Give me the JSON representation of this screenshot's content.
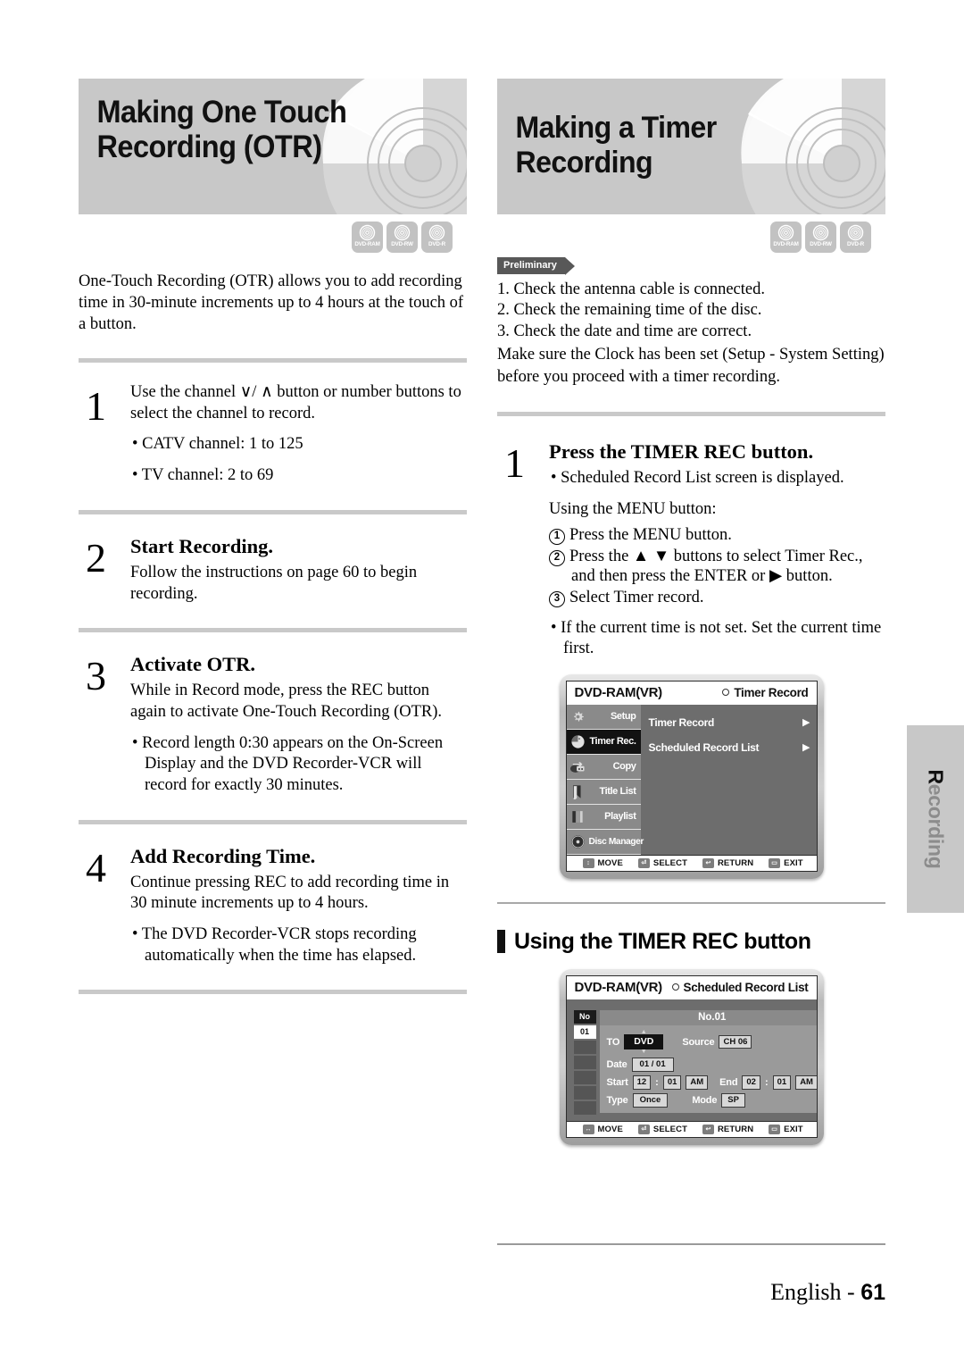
{
  "left": {
    "banner_title": "Making One Touch\nRecording (OTR)",
    "badges": [
      {
        "label": "DVD-RAM"
      },
      {
        "label": "DVD-RW"
      },
      {
        "label": "DVD-R"
      }
    ],
    "intro": "One-Touch Recording (OTR) allows you to add recording time in 30-minute increments up to 4 hours at the touch of a button.",
    "steps": [
      {
        "num": "1",
        "title": "",
        "para": "Use the channel ∨/ ∧ button or number buttons to select the channel to record.",
        "bullets": [
          "• CATV channel: 1 to 125",
          "• TV channel: 2 to 69"
        ]
      },
      {
        "num": "2",
        "title": "Start Recording.",
        "para": "Follow the instructions on page 60 to begin recording.",
        "bullets": []
      },
      {
        "num": "3",
        "title": "Activate OTR.",
        "para": "While in Record mode, press the REC button again to activate One-Touch Recording (OTR).",
        "bullets": [
          "• Record length 0:30 appears on the On-Screen Display and the DVD Recorder-VCR will record for exactly 30 minutes."
        ]
      },
      {
        "num": "4",
        "title": "Add Recording Time.",
        "para": "Continue pressing REC to add recording time in 30 minute increments up to 4 hours.",
        "bullets": [
          "• The DVD Recorder-VCR stops recording automatically when the time has elapsed."
        ]
      }
    ]
  },
  "right": {
    "banner_title": "Making a Timer Recording",
    "badges": [
      {
        "label": "DVD-RAM"
      },
      {
        "label": "DVD-RW"
      },
      {
        "label": "DVD-R"
      }
    ],
    "preliminary_tag": "Preliminary",
    "preliminary_lines": [
      "1. Check the antenna cable is connected.",
      "2. Check the remaining time of the disc.",
      "3. Check the date and time are correct."
    ],
    "preliminary_note_1": "Make sure the Clock has been set (Setup - System Setting)",
    "preliminary_note_2": "before you proceed with a timer recording.",
    "step": {
      "num": "1",
      "title": "Press the TIMER REC button.",
      "bullet_1": "• Scheduled Record List screen is displayed.",
      "using_menu": "Using the MENU button:",
      "sub_items": [
        {
          "n": "1",
          "text": "Press the MENU button."
        },
        {
          "n": "2",
          "text": "Press the ▲ ▼ buttons to select Timer Rec., and then press the ENTER or ▶ button."
        },
        {
          "n": "3",
          "text": "Select Timer record."
        }
      ],
      "bullet_2": "• If the current time is not set. Set the current time first."
    },
    "subheading": "Using the TIMER REC button"
  },
  "osd_menu": {
    "disc_type": "DVD-RAM(VR)",
    "screen_title": "Timer Record",
    "sidebar": [
      {
        "label": "Setup",
        "icon": "gear-icon",
        "selected": false
      },
      {
        "label": "Timer Rec.",
        "icon": "clock-icon",
        "selected": true
      },
      {
        "label": "Copy",
        "icon": "copy-icon",
        "selected": false
      },
      {
        "label": "Title List",
        "icon": "title-list-icon",
        "selected": false
      },
      {
        "label": "Playlist",
        "icon": "playlist-icon",
        "selected": false
      },
      {
        "label": "Disc Manager",
        "icon": "disc-manager-icon",
        "selected": false
      }
    ],
    "rows": [
      {
        "label": "Timer Record",
        "arrow": "▶"
      },
      {
        "label": "Scheduled Record List",
        "arrow": "▶"
      }
    ],
    "footer": [
      {
        "key": "↕",
        "label": "MOVE"
      },
      {
        "key": "⏎",
        "label": "SELECT"
      },
      {
        "key": "↩",
        "label": "RETURN"
      },
      {
        "key": "▭",
        "label": "EXIT"
      }
    ]
  },
  "osd_list": {
    "disc_type": "DVD-RAM(VR)",
    "screen_title": "Scheduled Record List",
    "col_header": "No",
    "col_rows": [
      "01",
      "",
      "",
      "",
      "",
      ""
    ],
    "panel_title": "No.01",
    "fields": {
      "to_label": "TO",
      "to_value": "DVD",
      "source_label": "Source",
      "source_value": "CH 06",
      "date_label": "Date",
      "date_value": "01 / 01",
      "start_label": "Start",
      "start_hour": "12",
      "start_min": "01",
      "start_ampm": "AM",
      "end_label": "End",
      "end_hour": "02",
      "end_min": "01",
      "end_ampm": "AM",
      "type_label": "Type",
      "type_value": "Once",
      "mode_label": "Mode",
      "mode_value": "SP"
    },
    "side_arrow": "▶",
    "footer": [
      {
        "key": "↔",
        "label": "MOVE"
      },
      {
        "key": "⏎",
        "label": "SELECT"
      },
      {
        "key": "↩",
        "label": "RETURN"
      },
      {
        "key": "▭",
        "label": "EXIT"
      }
    ]
  },
  "side_tab": {
    "first": "R",
    "rest": "ecording"
  },
  "footer": {
    "language": "English - ",
    "page": "61"
  }
}
